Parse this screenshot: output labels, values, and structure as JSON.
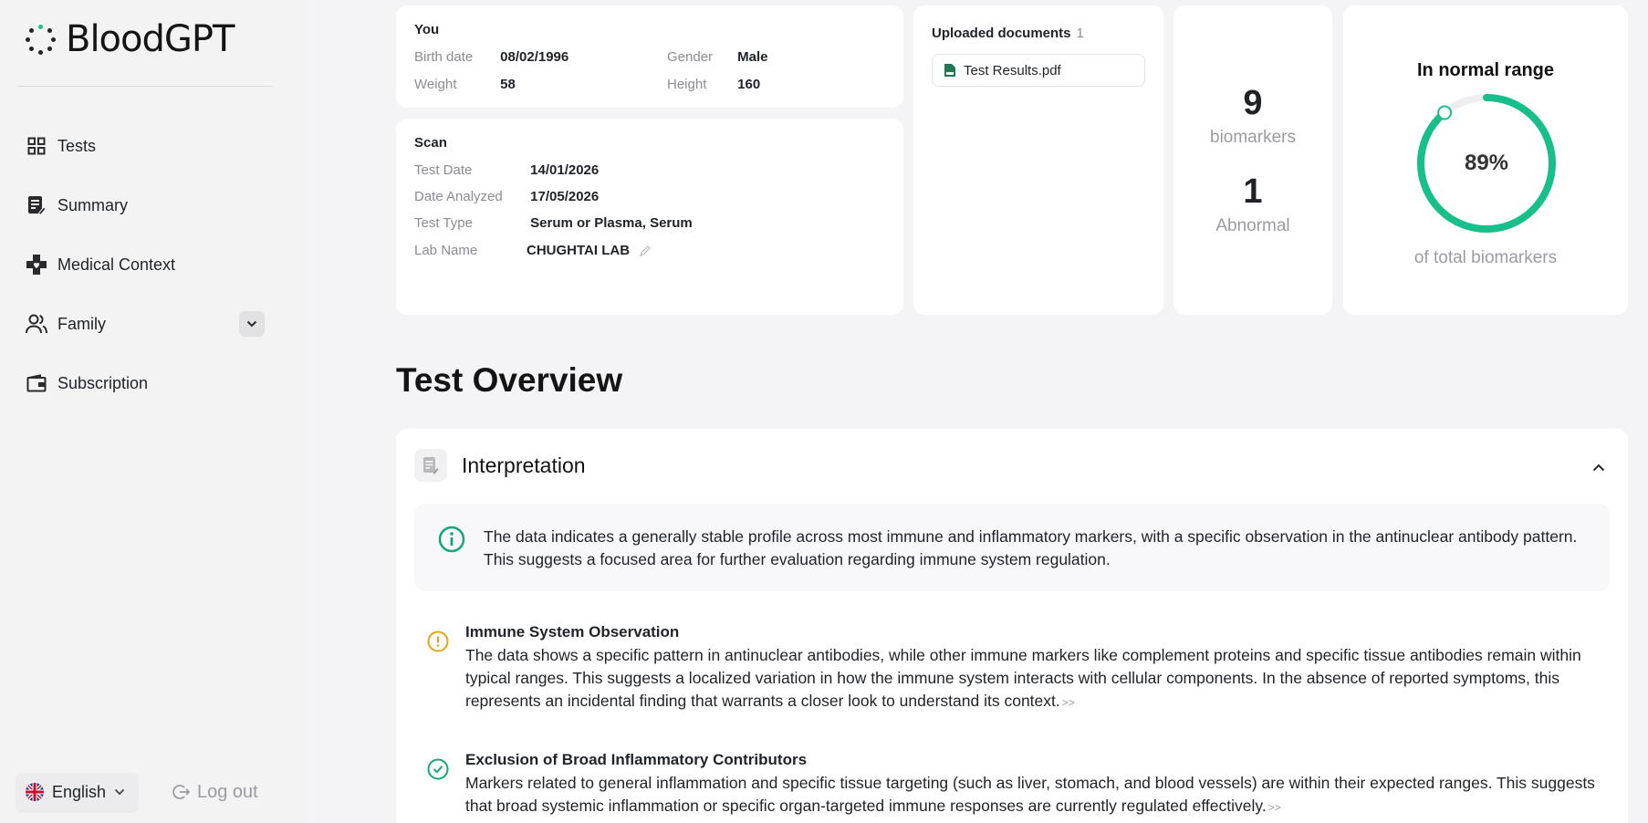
{
  "app": {
    "name": "BloodGPT"
  },
  "sidebar": {
    "items": [
      {
        "label": "Tests",
        "icon": "grid-icon"
      },
      {
        "label": "Summary",
        "icon": "document-edit-icon"
      },
      {
        "label": "Medical Context",
        "icon": "medical-cross-icon"
      },
      {
        "label": "Family",
        "icon": "users-icon"
      },
      {
        "label": "Subscription",
        "icon": "wallet-icon"
      }
    ],
    "language": "English",
    "logout": "Log out"
  },
  "profile": {
    "title": "You",
    "birth_date_label": "Birth date",
    "birth_date": "08/02/1996",
    "gender_label": "Gender",
    "gender": "Male",
    "weight_label": "Weight",
    "weight": "58",
    "height_label": "Height",
    "height": "160"
  },
  "scan": {
    "title": "Scan",
    "test_date_label": "Test Date",
    "test_date": "14/01/2026",
    "date_analyzed_label": "Date Analyzed",
    "date_analyzed": "17/05/2026",
    "test_type_label": "Test Type",
    "test_type": "Serum or Plasma, Serum",
    "lab_name_label": "Lab Name",
    "lab_name": "CHUGHTAI LAB"
  },
  "documents": {
    "title": "Uploaded documents",
    "count": "1",
    "files": [
      "Test Results.pdf"
    ]
  },
  "stats": {
    "biomarkers_count": "9",
    "biomarkers_label": "biomarkers",
    "abnormal_count": "1",
    "abnormal_label": "Abnormal"
  },
  "range": {
    "title": "In normal range",
    "percent_label": "89%",
    "percent_value": 89,
    "subtitle": "of total biomarkers"
  },
  "overview": {
    "title": "Test Overview",
    "interpretation_title": "Interpretation",
    "note": "The data indicates a generally stable profile across most immune and inflammatory markers, with a specific observation in the antinuclear antibody pattern. This suggests a focused area for further evaluation regarding immune system regulation.",
    "findings": [
      {
        "title": "Immune System Observation",
        "text": "The data shows a specific pattern in antinuclear antibodies, while other immune markers like complement proteins and specific tissue antibodies remain within typical ranges. This suggests a localized variation in how the immune system interacts with cellular components. In the absence of reported symptoms, this represents an incidental finding that warrants a closer look to understand its context.",
        "more": ">>"
      },
      {
        "title": "Exclusion of Broad Inflammatory Contributors",
        "text": "Markers related to general inflammation and specific tissue targeting (such as liver, stomach, and blood vessels) are within their expected ranges. This suggests that broad systemic inflammation or specific organ-targeted immune responses are currently regulated effectively.",
        "more": ">>"
      }
    ]
  },
  "colors": {
    "accent_green": "#17c08a",
    "warning_amber": "#e8a317",
    "ok_teal": "#17a67a",
    "muted": "#9b9ba3"
  }
}
